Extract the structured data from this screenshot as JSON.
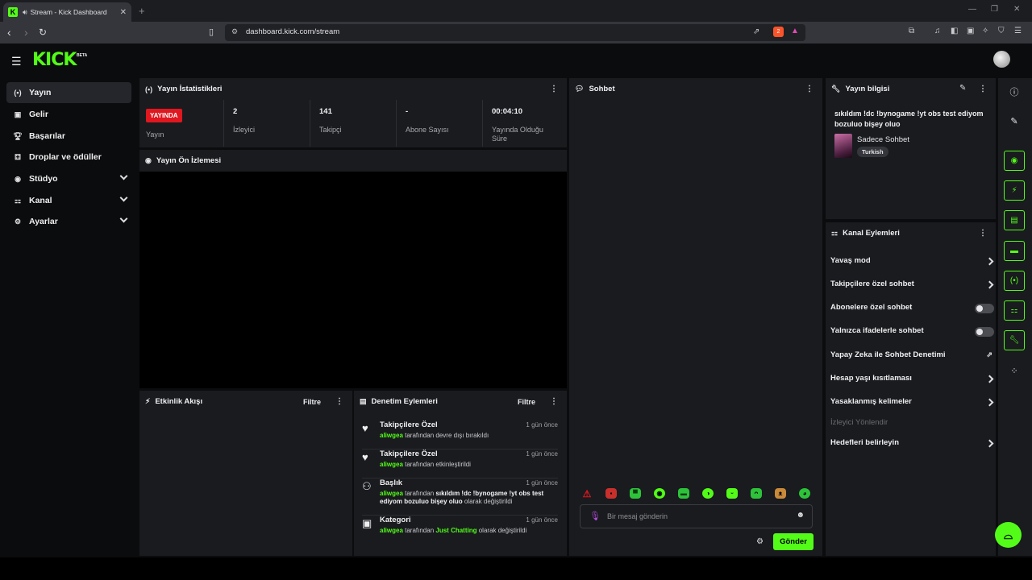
{
  "browser": {
    "tab_title": "Stream - Kick Dashboard",
    "tab_favicon": "K",
    "new_tab": "+",
    "url": "dashboard.kick.com/stream",
    "brave_badge": "2"
  },
  "app": {
    "logo": "KICK",
    "logo_badge": "BETA"
  },
  "sidebar": {
    "items": [
      {
        "label": "Yayın",
        "icon": "broadcast-icon"
      },
      {
        "label": "Gelir",
        "icon": "wallet-icon"
      },
      {
        "label": "Başarılar",
        "icon": "trophy-icon"
      },
      {
        "label": "Droplar ve ödüller",
        "icon": "gift-icon"
      },
      {
        "label": "Stüdyo",
        "icon": "studio-icon"
      },
      {
        "label": "Kanal",
        "icon": "channel-icon"
      },
      {
        "label": "Ayarlar",
        "icon": "gear-icon"
      }
    ]
  },
  "stats_panel": {
    "title": "Yayın İstatistikleri",
    "live_badge": "YAYINDA",
    "live_label": "Yayın",
    "viewers_value": "2",
    "viewers_label": "İzleyici",
    "followers_value": "141",
    "followers_label": "Takipçi",
    "subs_value": "-",
    "subs_label": "Abone Sayısı",
    "uptime_value": "00:04:10",
    "uptime_label": "Yayında Olduğu Süre"
  },
  "preview_panel": {
    "title": "Yayın Ön İzlemesi"
  },
  "activity_panel": {
    "title": "Etkinlik Akışı",
    "filter": "Filtre"
  },
  "mod_panel": {
    "title": "Denetim Eylemleri",
    "filter": "Filtre",
    "actions": [
      {
        "title": "Takipçilere Özel",
        "time": "1 gün önce",
        "user": "aliwgea",
        "text1": " tarafından devre dışı bırakıldı"
      },
      {
        "title": "Takipçilere Özel",
        "time": "1 gün önce",
        "user": "aliwgea",
        "text1": " tarafından etkinleştirildi"
      },
      {
        "title": "Başlık",
        "time": "1 gün önce",
        "user": "aliwgea",
        "text1": " tarafından ",
        "value": "sıkıldım !dc !bynogame !yt obs test ediyom bozuluo bişey oluo",
        "text2": " olarak değiştirildi"
      },
      {
        "title": "Kategori",
        "time": "1 gün önce",
        "user": "aliwgea",
        "text1": " tarafından ",
        "value": "Just Chatting",
        "text2": " olarak değiştirildi"
      }
    ]
  },
  "chat_panel": {
    "title": "Sohbet",
    "placeholder": "Bir mesaj gönderin",
    "send": "Gönder"
  },
  "stream_info": {
    "title": "Yayın bilgisi",
    "stream_title": "sıkıldım !dc !bynogame !yt obs test ediyom bozuluo bişey oluo",
    "category": "Sadece Sohbet",
    "language": "Turkish"
  },
  "channel_actions": {
    "title": "Kanal Eylemleri",
    "items": [
      {
        "label": "Yavaş mod",
        "control": "arrow"
      },
      {
        "label": "Takipçilere özel sohbet",
        "control": "arrow"
      },
      {
        "label": "Abonelere özel sohbet",
        "control": "toggle",
        "state": "off"
      },
      {
        "label": "Yalnızca ifadelerle sohbet",
        "control": "toggle",
        "state": "off"
      },
      {
        "label": "Yapay Zeka ile Sohbet Denetimi",
        "control": "external"
      },
      {
        "label": "Hesap yaşı kısıtlaması",
        "control": "arrow"
      },
      {
        "label": "Yasaklanmış kelimeler",
        "control": "arrow"
      },
      {
        "label": "İzleyici Yönlendir",
        "control": "disabled"
      },
      {
        "label": "Hedefleri belirleyin",
        "control": "arrow"
      }
    ]
  },
  "colors": {
    "accent": "#53fc18",
    "live": "#e0171f",
    "panel": "#191b1f",
    "background": "#0b0c0d"
  }
}
